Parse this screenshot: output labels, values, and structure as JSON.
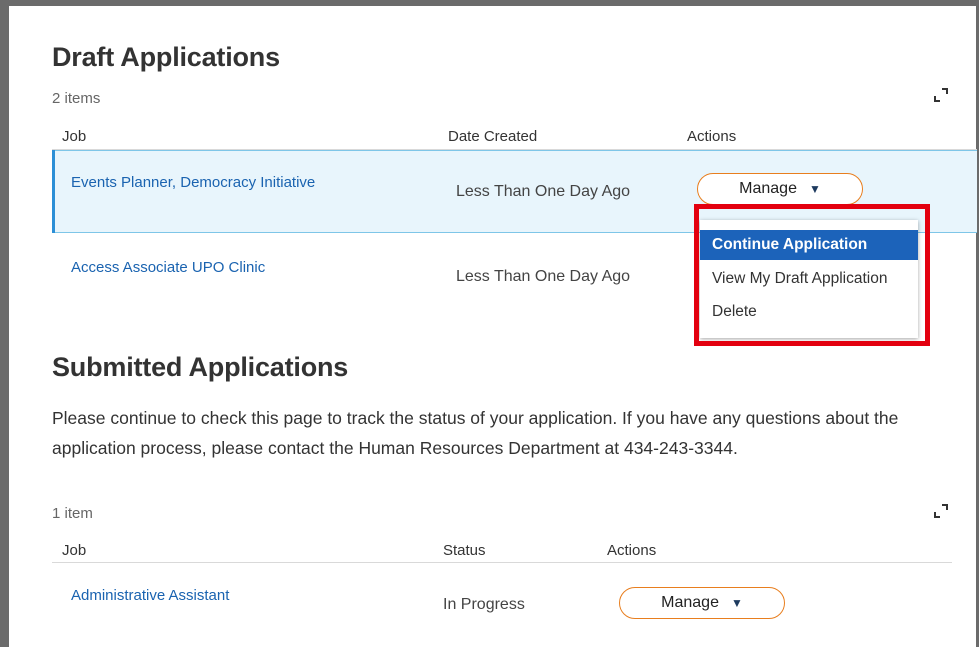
{
  "draft": {
    "title": "Draft Applications",
    "count": "2 items",
    "columns": {
      "job": "Job",
      "date": "Date Created",
      "actions": "Actions"
    },
    "rows": [
      {
        "job": "Events Planner, Democracy Initiative",
        "date": "Less Than One Day Ago",
        "action": "Manage"
      },
      {
        "job": "Access Associate UPO Clinic",
        "date": "Less Than One Day Ago"
      }
    ],
    "menu": [
      "Continue Application",
      "View My Draft Application",
      "Delete"
    ]
  },
  "submitted": {
    "title": "Submitted Applications",
    "description": "Please continue to check this page to track the status of your application. If you have any questions about the application process, please contact the Human Resources Department at 434-243-3344.",
    "count": "1 item",
    "columns": {
      "job": "Job",
      "status": "Status",
      "actions": "Actions"
    },
    "rows": [
      {
        "job": "Administrative Assistant",
        "status": "In Progress",
        "action": "Manage"
      }
    ]
  },
  "colors": {
    "accent_orange": "#e87e1e",
    "link_blue": "#1a63b0",
    "highlight_red": "#e3000f",
    "menu_active": "#1c63ba"
  },
  "icons": {
    "expand": "expand-icon",
    "caret": "caret-down-icon"
  }
}
